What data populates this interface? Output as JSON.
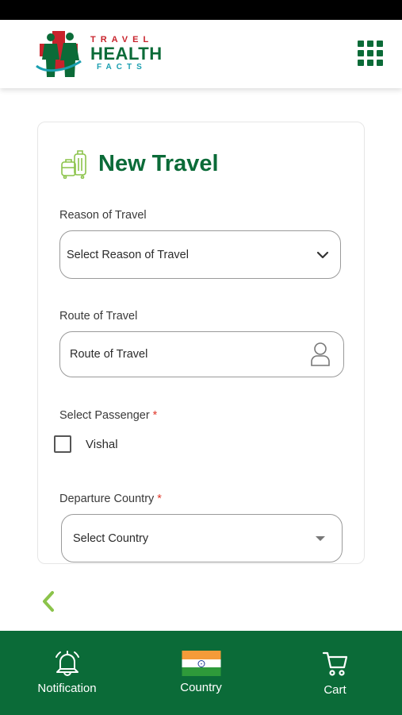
{
  "header": {
    "logo_text": [
      "TRAVEL",
      "HEALTH",
      "FACTS"
    ],
    "menu_icon": "grid-menu-icon"
  },
  "card": {
    "title": "New Travel",
    "title_icon": "luggage-icon",
    "reason": {
      "label": "Reason of Travel",
      "value": "Select Reason of Travel",
      "icon": "chevron-down-icon"
    },
    "route": {
      "label": "Route of Travel",
      "placeholder": "Route of Travel",
      "icon": "person-icon"
    },
    "passenger": {
      "label": "Select Passenger",
      "required_mark": "*",
      "options": [
        {
          "name": "Vishal",
          "checked": false
        }
      ]
    },
    "departure": {
      "label": "Departure Country",
      "required_mark": "*",
      "value": "Select Country",
      "icon": "caret-down-icon"
    }
  },
  "back_icon": "chevron-left-icon",
  "bottom_nav": {
    "items": [
      {
        "label": "Notification",
        "icon": "bell-icon"
      },
      {
        "label": "Country",
        "icon": "india-flag-icon"
      },
      {
        "label": "Cart",
        "icon": "cart-icon"
      }
    ]
  },
  "colors": {
    "brand_green": "#0b6b38",
    "brand_red": "#c8232c",
    "accent_teal": "#1a9fb0",
    "light_green": "#8bc34a",
    "required_red": "#e0392b"
  }
}
